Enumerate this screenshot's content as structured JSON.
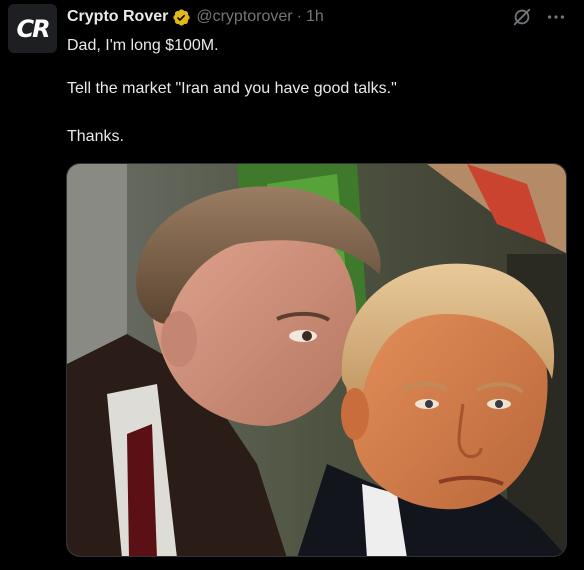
{
  "post": {
    "author": {
      "display_name": "Crypto Rover",
      "handle": "@cryptorover",
      "avatar_text": "CR",
      "verified": true
    },
    "separator": "·",
    "timestamp": "1h",
    "text_lines": [
      "Dad, I'm long $100M.",
      "Tell the market \"Iran and you have good talks.\"",
      "Thanks."
    ],
    "media": {
      "type": "photo"
    }
  },
  "icons": {
    "verified": "verified-badge-icon",
    "grok": "grok-icon",
    "more": "more-options-icon"
  },
  "colors": {
    "background": "#000000",
    "primary_text": "#e7e9ea",
    "secondary_text": "#71767b",
    "verified_gold": "#e2b719"
  }
}
